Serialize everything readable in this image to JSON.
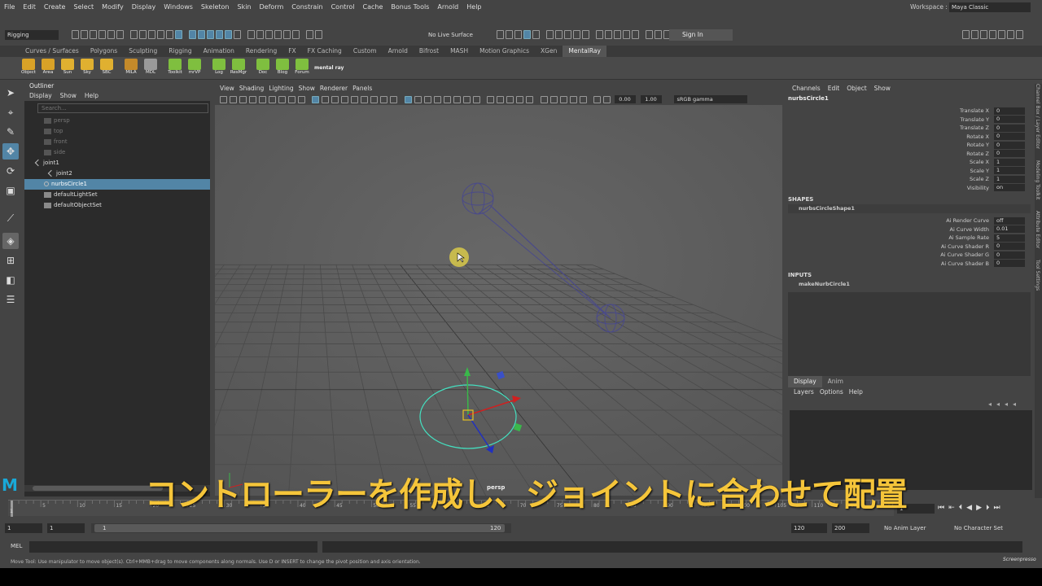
{
  "menubar": {
    "items": [
      "File",
      "Edit",
      "Create",
      "Select",
      "Modify",
      "Display",
      "Windows",
      "Skeleton",
      "Skin",
      "Deform",
      "Constrain",
      "Control",
      "Cache",
      "Bonus Tools",
      "Arnold",
      "Help"
    ],
    "workspace_label": "Workspace :",
    "workspace_value": "Maya Classic"
  },
  "statusline": {
    "mode": "Rigging",
    "live_surface": "No Live Surface",
    "sign_in": "Sign In"
  },
  "shelf_tabs": [
    "Curves / Surfaces",
    "Polygons",
    "Sculpting",
    "Rigging",
    "Animation",
    "Rendering",
    "FX",
    "FX Caching",
    "Custom",
    "Arnold",
    "Bifrost",
    "MASH",
    "Motion Graphics",
    "XGen",
    "MentalRay"
  ],
  "shelf_active": "MentalRay",
  "shelf_buttons": [
    {
      "label": "Object",
      "color": "#d9a227"
    },
    {
      "label": "Area",
      "color": "#d9a227"
    },
    {
      "label": "Sun",
      "color": "#e0b030"
    },
    {
      "label": "Sky",
      "color": "#e0b030"
    },
    {
      "label": "SBC",
      "color": "#e0b030"
    },
    {
      "label": "MILA",
      "color": "#c48a2a"
    },
    {
      "label": "MDL",
      "color": "#9a9a9a"
    },
    {
      "label": "Toolkit",
      "color": "#7fbf3f"
    },
    {
      "label": "mrVP",
      "color": "#7fbf3f"
    },
    {
      "label": "Log",
      "color": "#7fbf3f"
    },
    {
      "label": "ResMgr",
      "color": "#7fbf3f"
    },
    {
      "label": "Doc",
      "color": "#7fbf3f"
    },
    {
      "label": "Blog",
      "color": "#7fbf3f"
    },
    {
      "label": "Forum",
      "color": "#7fbf3f"
    }
  ],
  "shelf_logo": "mental ray",
  "outliner": {
    "title": "Outliner",
    "menu": [
      "Display",
      "Show",
      "Help"
    ],
    "search_placeholder": "Search...",
    "items": [
      {
        "label": "persp",
        "state": "dim",
        "indent": 24
      },
      {
        "label": "top",
        "state": "dim",
        "indent": 24
      },
      {
        "label": "front",
        "state": "dim",
        "indent": 24
      },
      {
        "label": "side",
        "state": "dim",
        "indent": 24
      },
      {
        "label": "joint1",
        "state": "normal",
        "indent": 14
      },
      {
        "label": "joint2",
        "state": "normal",
        "indent": 30
      },
      {
        "label": "nurbsCircle1",
        "state": "selected",
        "indent": 24
      },
      {
        "label": "defaultLightSet",
        "state": "normal",
        "indent": 24
      },
      {
        "label": "defaultObjectSet",
        "state": "normal",
        "indent": 24
      }
    ]
  },
  "viewport": {
    "menu": [
      "View",
      "Shading",
      "Lighting",
      "Show",
      "Renderer",
      "Panels"
    ],
    "exposure": "0.00",
    "gamma": "1.00",
    "color_space": "sRGB gamma",
    "camera_label": "persp"
  },
  "channelbox": {
    "menu": [
      "Channels",
      "Edit",
      "Object",
      "Show"
    ],
    "object": "nurbsCircle1",
    "attributes": [
      {
        "name": "Translate X",
        "value": "0"
      },
      {
        "name": "Translate Y",
        "value": "0"
      },
      {
        "name": "Translate Z",
        "value": "0"
      },
      {
        "name": "Rotate X",
        "value": "0"
      },
      {
        "name": "Rotate Y",
        "value": "0"
      },
      {
        "name": "Rotate Z",
        "value": "0"
      },
      {
        "name": "Scale X",
        "value": "1"
      },
      {
        "name": "Scale Y",
        "value": "1"
      },
      {
        "name": "Scale Z",
        "value": "1"
      },
      {
        "name": "Visibility",
        "value": "on"
      }
    ],
    "shapes_label": "SHAPES",
    "shape_name": "nurbsCircleShape1",
    "shape_attributes": [
      {
        "name": "Ai Render Curve",
        "value": "off"
      },
      {
        "name": "Ai Curve Width",
        "value": "0.01"
      },
      {
        "name": "Ai Sample Rate",
        "value": "5"
      },
      {
        "name": "Ai Curve Shader R",
        "value": "0"
      },
      {
        "name": "Ai Curve Shader G",
        "value": "0"
      },
      {
        "name": "Ai Curve Shader B",
        "value": "0"
      }
    ],
    "inputs_label": "INPUTS",
    "input_name": "makeNurbCircle1"
  },
  "side_tabs": [
    "Channel Box / Layer Editor",
    "Modeling Toolkit",
    "Attribute Editor",
    "Tool Settings"
  ],
  "layer_editor": {
    "tabs": [
      "Display",
      "Anim"
    ],
    "menu": [
      "Layers",
      "Options",
      "Help"
    ]
  },
  "timeline": {
    "ticks": [
      "1",
      "5",
      "10",
      "15",
      "20",
      "25",
      "30",
      "35",
      "40",
      "45",
      "50",
      "55",
      "60",
      "65",
      "70",
      "75",
      "80",
      "85",
      "90",
      "95",
      "100",
      "105",
      "110",
      "115",
      "120"
    ],
    "current_frame": "1"
  },
  "range": {
    "start": "1",
    "playback_start": "1",
    "slider_start": "1",
    "slider_end": "120",
    "playback_end": "120",
    "end": "200",
    "anim_layer": "No Anim Layer",
    "char_set": "No Character Set"
  },
  "cmdline": {
    "label": "MEL"
  },
  "helpline": {
    "text": "Move Tool: Use manipulator to move object(s). Ctrl+MMB+drag to move components along normals. Use D or INSERT to change the pivot position and axis orientation."
  },
  "subtitle": "コントローラーを作成し、ジョイントに合わせて配置",
  "watermark": "Screenpresso"
}
